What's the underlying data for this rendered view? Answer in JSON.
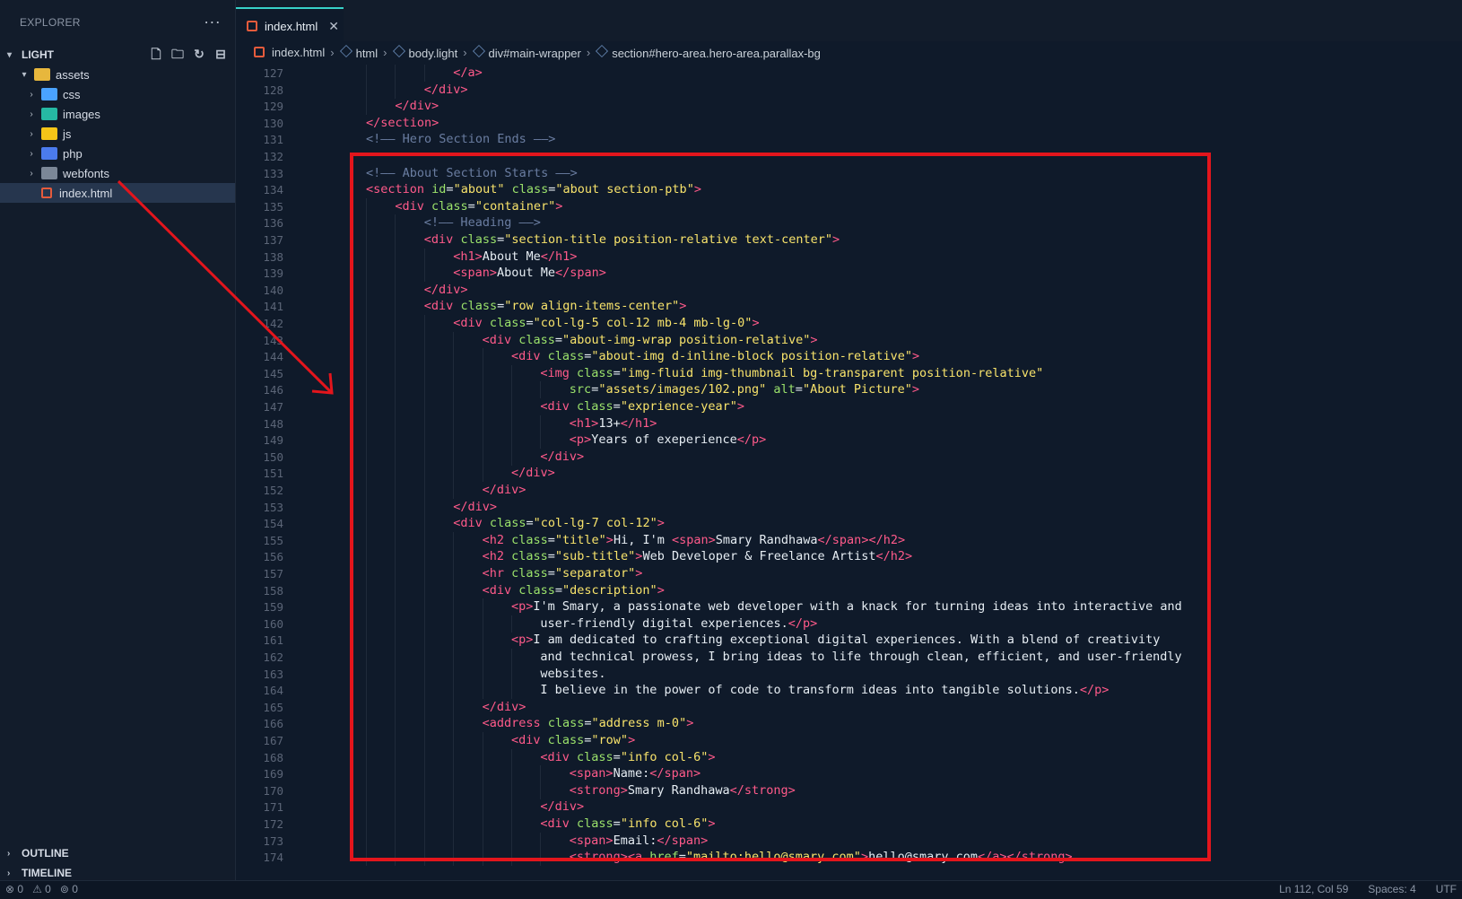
{
  "sidebar": {
    "title": "EXPLORER",
    "more": "···",
    "project": "LIGHT",
    "tree": [
      {
        "name": "assets",
        "level": 1,
        "type": "folder",
        "color": "#e7b73d",
        "expanded": true
      },
      {
        "name": "css",
        "level": 2,
        "type": "folder",
        "color": "#4aa3ff"
      },
      {
        "name": "images",
        "level": 2,
        "type": "folder",
        "color": "#26b9a3"
      },
      {
        "name": "js",
        "level": 2,
        "type": "folder",
        "color": "#f5c518"
      },
      {
        "name": "php",
        "level": 2,
        "type": "folder",
        "color": "#4b7bec"
      },
      {
        "name": "webfonts",
        "level": 2,
        "type": "folder",
        "color": "#7b8797"
      },
      {
        "name": "index.html",
        "level": 2,
        "type": "file",
        "selected": true
      }
    ],
    "outline": "OUTLINE",
    "timeline": "TIMELINE"
  },
  "tab": {
    "label": "index.html",
    "close": "✕"
  },
  "breadcrumb": [
    "index.html",
    "html",
    "body.light",
    "div#main-wrapper",
    "section#hero-area.hero-area.parallax-bg"
  ],
  "editor": {
    "lines": [
      {
        "n": "127",
        "i": 3,
        "t": [
          [
            "tag",
            "</a>"
          ]
        ]
      },
      {
        "n": "128",
        "i": 2,
        "t": [
          [
            "tag",
            "</div>"
          ]
        ]
      },
      {
        "n": "129",
        "i": 1,
        "t": [
          [
            "tag",
            "</div>"
          ]
        ]
      },
      {
        "n": "130",
        "i": 0,
        "t": [
          [
            "tag",
            "</section>"
          ]
        ]
      },
      {
        "n": "131",
        "i": 0,
        "t": [
          [
            "cm",
            "<!—— Hero Section Ends ——>"
          ]
        ]
      },
      {
        "n": "132",
        "i": 0,
        "t": []
      },
      {
        "n": "133",
        "i": 0,
        "t": [
          [
            "cm",
            "<!—— About Section Starts ——>"
          ]
        ]
      },
      {
        "n": "134",
        "i": 0,
        "t": [
          [
            "tag",
            "<section "
          ],
          [
            "attr",
            "id"
          ],
          [
            "txt",
            "="
          ],
          [
            "str",
            "\"about\""
          ],
          [
            "txt",
            " "
          ],
          [
            "attr",
            "class"
          ],
          [
            "txt",
            "="
          ],
          [
            "str",
            "\"about section-ptb\""
          ],
          [
            "tag",
            ">"
          ]
        ]
      },
      {
        "n": "135",
        "i": 1,
        "t": [
          [
            "tag",
            "<div "
          ],
          [
            "attr",
            "class"
          ],
          [
            "txt",
            "="
          ],
          [
            "str",
            "\"container\""
          ],
          [
            "tag",
            ">"
          ]
        ]
      },
      {
        "n": "136",
        "i": 2,
        "t": [
          [
            "cm",
            "<!—— Heading ——>"
          ]
        ]
      },
      {
        "n": "137",
        "i": 2,
        "t": [
          [
            "tag",
            "<div "
          ],
          [
            "attr",
            "class"
          ],
          [
            "txt",
            "="
          ],
          [
            "str",
            "\"section-title position-relative text-center\""
          ],
          [
            "tag",
            ">"
          ]
        ]
      },
      {
        "n": "138",
        "i": 3,
        "t": [
          [
            "tag",
            "<h1>"
          ],
          [
            "txt",
            "About Me"
          ],
          [
            "tag",
            "</h1>"
          ]
        ]
      },
      {
        "n": "139",
        "i": 3,
        "t": [
          [
            "tag",
            "<span>"
          ],
          [
            "txt",
            "About Me"
          ],
          [
            "tag",
            "</span>"
          ]
        ]
      },
      {
        "n": "140",
        "i": 2,
        "t": [
          [
            "tag",
            "</div>"
          ]
        ]
      },
      {
        "n": "141",
        "i": 2,
        "t": [
          [
            "tag",
            "<div "
          ],
          [
            "attr",
            "class"
          ],
          [
            "txt",
            "="
          ],
          [
            "str",
            "\"row align-items-center\""
          ],
          [
            "tag",
            ">"
          ]
        ]
      },
      {
        "n": "142",
        "i": 3,
        "t": [
          [
            "tag",
            "<div "
          ],
          [
            "attr",
            "class"
          ],
          [
            "txt",
            "="
          ],
          [
            "str",
            "\"col-lg-5 col-12 mb-4 mb-lg-0\""
          ],
          [
            "tag",
            ">"
          ]
        ]
      },
      {
        "n": "143",
        "i": 4,
        "t": [
          [
            "tag",
            "<div "
          ],
          [
            "attr",
            "class"
          ],
          [
            "txt",
            "="
          ],
          [
            "str",
            "\"about-img-wrap position-relative\""
          ],
          [
            "tag",
            ">"
          ]
        ]
      },
      {
        "n": "144",
        "i": 5,
        "t": [
          [
            "tag",
            "<div "
          ],
          [
            "attr",
            "class"
          ],
          [
            "txt",
            "="
          ],
          [
            "str",
            "\"about-img d-inline-block position-relative\""
          ],
          [
            "tag",
            ">"
          ]
        ]
      },
      {
        "n": "145",
        "i": 6,
        "t": [
          [
            "tag",
            "<img "
          ],
          [
            "attr",
            "class"
          ],
          [
            "txt",
            "="
          ],
          [
            "str",
            "\"img-fluid img-thumbnail bg-transparent position-relative\""
          ]
        ]
      },
      {
        "n": "146",
        "i": 7,
        "t": [
          [
            "attr",
            "src"
          ],
          [
            "txt",
            "="
          ],
          [
            "str",
            "\"assets/images/102.png\""
          ],
          [
            "txt",
            " "
          ],
          [
            "attr",
            "alt"
          ],
          [
            "txt",
            "="
          ],
          [
            "str",
            "\"About Picture\""
          ],
          [
            "tag",
            ">"
          ]
        ]
      },
      {
        "n": "147",
        "i": 6,
        "t": [
          [
            "tag",
            "<div "
          ],
          [
            "attr",
            "class"
          ],
          [
            "txt",
            "="
          ],
          [
            "str",
            "\"exprience-year\""
          ],
          [
            "tag",
            ">"
          ]
        ]
      },
      {
        "n": "148",
        "i": 7,
        "t": [
          [
            "tag",
            "<h1>"
          ],
          [
            "txt",
            "13+"
          ],
          [
            "tag",
            "</h1>"
          ]
        ]
      },
      {
        "n": "149",
        "i": 7,
        "t": [
          [
            "tag",
            "<p>"
          ],
          [
            "txt",
            "Years of exeperience"
          ],
          [
            "tag",
            "</p>"
          ]
        ]
      },
      {
        "n": "150",
        "i": 6,
        "t": [
          [
            "tag",
            "</div>"
          ]
        ]
      },
      {
        "n": "151",
        "i": 5,
        "t": [
          [
            "tag",
            "</div>"
          ]
        ]
      },
      {
        "n": "152",
        "i": 4,
        "t": [
          [
            "tag",
            "</div>"
          ]
        ]
      },
      {
        "n": "153",
        "i": 3,
        "t": [
          [
            "tag",
            "</div>"
          ]
        ]
      },
      {
        "n": "154",
        "i": 3,
        "t": [
          [
            "tag",
            "<div "
          ],
          [
            "attr",
            "class"
          ],
          [
            "txt",
            "="
          ],
          [
            "str",
            "\"col-lg-7 col-12\""
          ],
          [
            "tag",
            ">"
          ]
        ]
      },
      {
        "n": "155",
        "i": 4,
        "t": [
          [
            "tag",
            "<h2 "
          ],
          [
            "attr",
            "class"
          ],
          [
            "txt",
            "="
          ],
          [
            "str",
            "\"title\""
          ],
          [
            "tag",
            ">"
          ],
          [
            "txt",
            "Hi, I'm "
          ],
          [
            "tag",
            "<span>"
          ],
          [
            "txt",
            "Smary Randhawa"
          ],
          [
            "tag",
            "</span></h2>"
          ]
        ]
      },
      {
        "n": "156",
        "i": 4,
        "t": [
          [
            "tag",
            "<h2 "
          ],
          [
            "attr",
            "class"
          ],
          [
            "txt",
            "="
          ],
          [
            "str",
            "\"sub-title\""
          ],
          [
            "tag",
            ">"
          ],
          [
            "txt",
            "Web Developer & Freelance Artist"
          ],
          [
            "tag",
            "</h2>"
          ]
        ]
      },
      {
        "n": "157",
        "i": 4,
        "t": [
          [
            "tag",
            "<hr "
          ],
          [
            "attr",
            "class"
          ],
          [
            "txt",
            "="
          ],
          [
            "str",
            "\"separator\""
          ],
          [
            "tag",
            ">"
          ]
        ]
      },
      {
        "n": "158",
        "i": 4,
        "t": [
          [
            "tag",
            "<div "
          ],
          [
            "attr",
            "class"
          ],
          [
            "txt",
            "="
          ],
          [
            "str",
            "\"description\""
          ],
          [
            "tag",
            ">"
          ]
        ]
      },
      {
        "n": "159",
        "i": 5,
        "t": [
          [
            "tag",
            "<p>"
          ],
          [
            "txt",
            "I'm Smary, a passionate web developer with a knack for turning ideas into interactive and"
          ]
        ]
      },
      {
        "n": "160",
        "i": 6,
        "t": [
          [
            "txt",
            "user-friendly digital experiences."
          ],
          [
            "tag",
            "</p>"
          ]
        ]
      },
      {
        "n": "161",
        "i": 5,
        "t": [
          [
            "tag",
            "<p>"
          ],
          [
            "txt",
            "I am dedicated to crafting exceptional digital experiences. With a blend of creativity"
          ]
        ]
      },
      {
        "n": "162",
        "i": 6,
        "t": [
          [
            "txt",
            "and technical prowess, I bring ideas to life through clean, efficient, and user-friendly"
          ]
        ]
      },
      {
        "n": "163",
        "i": 6,
        "t": [
          [
            "txt",
            "websites."
          ]
        ]
      },
      {
        "n": "164",
        "i": 6,
        "t": [
          [
            "txt",
            "I believe in the power of code to transform ideas into tangible solutions."
          ],
          [
            "tag",
            "</p>"
          ]
        ]
      },
      {
        "n": "165",
        "i": 4,
        "t": [
          [
            "tag",
            "</div>"
          ]
        ]
      },
      {
        "n": "166",
        "i": 4,
        "t": [
          [
            "tag",
            "<address "
          ],
          [
            "attr",
            "class"
          ],
          [
            "txt",
            "="
          ],
          [
            "str",
            "\"address m-0\""
          ],
          [
            "tag",
            ">"
          ]
        ]
      },
      {
        "n": "167",
        "i": 5,
        "t": [
          [
            "tag",
            "<div "
          ],
          [
            "attr",
            "class"
          ],
          [
            "txt",
            "="
          ],
          [
            "str",
            "\"row\""
          ],
          [
            "tag",
            ">"
          ]
        ]
      },
      {
        "n": "168",
        "i": 6,
        "t": [
          [
            "tag",
            "<div "
          ],
          [
            "attr",
            "class"
          ],
          [
            "txt",
            "="
          ],
          [
            "str",
            "\"info col-6\""
          ],
          [
            "tag",
            ">"
          ]
        ]
      },
      {
        "n": "169",
        "i": 7,
        "t": [
          [
            "tag",
            "<span>"
          ],
          [
            "txt",
            "Name:"
          ],
          [
            "tag",
            "</span>"
          ]
        ]
      },
      {
        "n": "170",
        "i": 7,
        "t": [
          [
            "tag",
            "<strong>"
          ],
          [
            "txt",
            "Smary Randhawa"
          ],
          [
            "tag",
            "</strong>"
          ]
        ]
      },
      {
        "n": "171",
        "i": 6,
        "t": [
          [
            "tag",
            "</div>"
          ]
        ]
      },
      {
        "n": "172",
        "i": 6,
        "t": [
          [
            "tag",
            "<div "
          ],
          [
            "attr",
            "class"
          ],
          [
            "txt",
            "="
          ],
          [
            "str",
            "\"info col-6\""
          ],
          [
            "tag",
            ">"
          ]
        ]
      },
      {
        "n": "173",
        "i": 7,
        "t": [
          [
            "tag",
            "<span>"
          ],
          [
            "txt",
            "Email:"
          ],
          [
            "tag",
            "</span>"
          ]
        ]
      },
      {
        "n": "174",
        "i": 7,
        "t": [
          [
            "tag",
            "<strong><a "
          ],
          [
            "attr",
            "href"
          ],
          [
            "txt",
            "="
          ],
          [
            "str",
            "\"mailto:hello@smary.com\""
          ],
          [
            "tag",
            ">"
          ],
          [
            "txt",
            "hello@smary.com"
          ],
          [
            "tag",
            "</a></strong>"
          ]
        ]
      }
    ]
  },
  "status": {
    "errors": "⊗ 0",
    "warnings": "⚠ 0",
    "ports": "⊚ 0",
    "position": "Ln 112, Col 59",
    "spaces": "Spaces: 4",
    "encoding": "UTF"
  },
  "colors": {
    "highlight": "#e3151c",
    "accent": "#38d1c9"
  }
}
